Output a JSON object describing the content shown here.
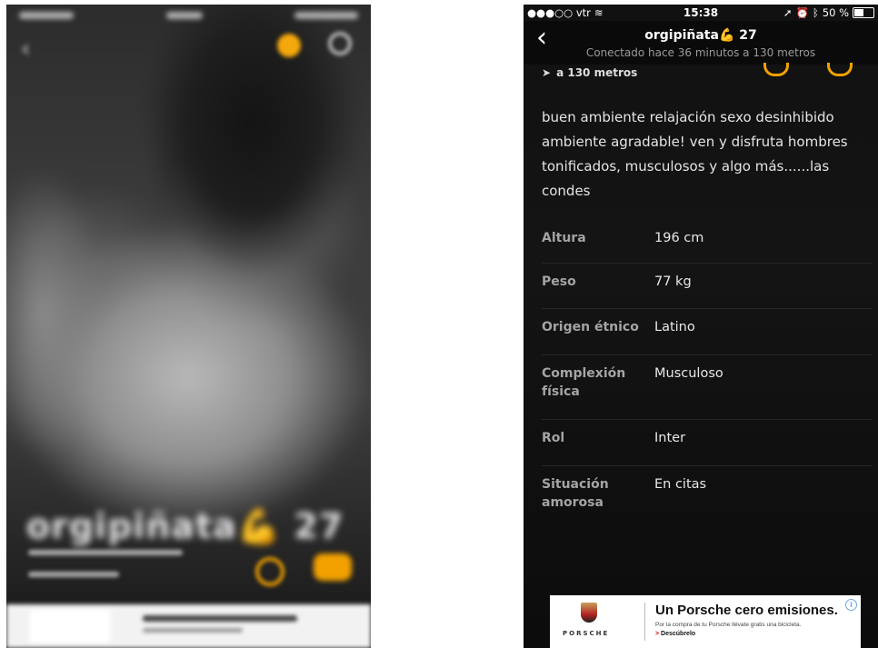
{
  "left_preview": {
    "name": "orgipiñata",
    "name_emoji": "💪",
    "age": "27"
  },
  "status_bar": {
    "carrier": "●●●○○ vtr",
    "time": "15:38",
    "battery": "50 %"
  },
  "header": {
    "name": "orgipiñata",
    "emoji": "💪",
    "age": "27",
    "subtitle": "Conectado hace 36 minutos   a 130 metros"
  },
  "distance": "a 130 metros",
  "bio": "buen ambiente relajación sexo desinhibido ambiente agradable! ven y disfruta hombres tonificados, musculosos y algo más......las condes",
  "details": [
    {
      "label": "Altura",
      "value": "196 cm"
    },
    {
      "label": "Peso",
      "value": "77 kg"
    },
    {
      "label": "Origen étnico",
      "value": "Latino"
    },
    {
      "label": "Complexión física",
      "value": "Musculoso"
    },
    {
      "label": "Rol",
      "value": "Inter"
    },
    {
      "label": "Situación amorosa",
      "value": "En citas"
    }
  ],
  "ad": {
    "brand": "PORSCHE",
    "headline": "Un Porsche cero emisiones.",
    "body": "Por la compra de tu Porsche llévate gratis una bicicleta.",
    "cta": "Descúbrelo",
    "info": "i"
  }
}
